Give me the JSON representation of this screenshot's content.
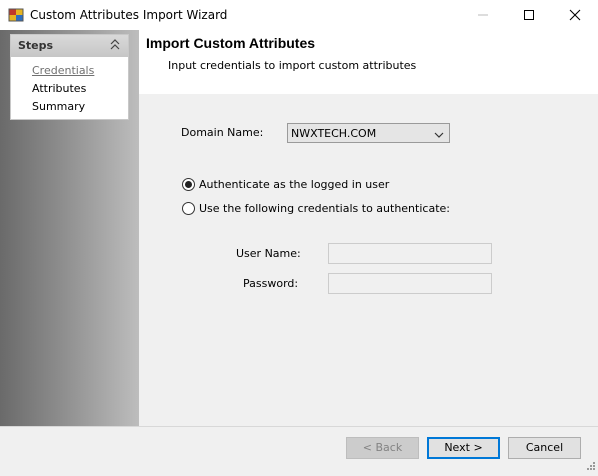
{
  "window": {
    "title": "Custom Attributes Import Wizard",
    "icon": "app-icon"
  },
  "steps": {
    "header": "Steps",
    "items": [
      {
        "label": "Credentials",
        "current": true
      },
      {
        "label": "Attributes",
        "current": false
      },
      {
        "label": "Summary",
        "current": false
      }
    ]
  },
  "page": {
    "title": "Import Custom Attributes",
    "subtitle": "Input credentials to import custom attributes"
  },
  "form": {
    "domain_label": "Domain Name:",
    "domain_value": "NWXTECH.COM",
    "auth_options": [
      {
        "label": "Authenticate as the logged in user",
        "selected": true
      },
      {
        "label": "Use the following credentials to authenticate:",
        "selected": false
      }
    ],
    "username_label": "User Name:",
    "username_value": "",
    "password_label": "Password:",
    "password_value": ""
  },
  "buttons": {
    "back": "< Back",
    "next": "Next >",
    "cancel": "Cancel"
  },
  "colors": {
    "accent": "#0078d7",
    "header_bg": "#ffffff",
    "body_bg": "#f0f0f0"
  }
}
